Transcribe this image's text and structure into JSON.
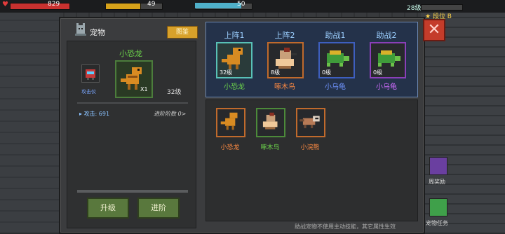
{
  "hud": {
    "hp_value": "829",
    "gold_value": "49",
    "energy_value": "50",
    "level_value": "28级",
    "rank_label": "段位 B",
    "hp_fraction": 1.0,
    "gold_fraction": 0.6,
    "energy_fraction": 0.8
  },
  "dialog": {
    "title": "宠物",
    "rank_button": "图鉴",
    "close_glyph": "✕"
  },
  "detail": {
    "pet_name": "小恐龙",
    "skill_label": "攻击仪",
    "count": "X1",
    "level": "32级",
    "attack": "攻击: 691",
    "advance_progress": "进阶阶数 0>",
    "upgrade_button": "升级",
    "advance_button": "进阶"
  },
  "lineup": {
    "slots": [
      {
        "header": "上阵1",
        "level": "32级",
        "name": "小恐龙",
        "name_color": "#6cd44b",
        "border": "#58c1b7"
      },
      {
        "header": "上阵2",
        "level": "8级",
        "name": "啄木鸟",
        "name_color": "#ff8b42",
        "border": "#c06a2c"
      },
      {
        "header": "助战1",
        "level": "0级",
        "name": "小乌龟",
        "name_color": "#6f94ff",
        "border": "#3e5fbf"
      },
      {
        "header": "助战2",
        "level": "0级",
        "name": "小乌龟",
        "name_color": "#d06cff",
        "border": "#8a3fb8"
      }
    ]
  },
  "inventory": {
    "items": [
      {
        "name": "小恐龙",
        "name_color": "#ff8b42",
        "border": "#c06a2c"
      },
      {
        "name": "啄木鸟",
        "name_color": "#6cd44b",
        "border": "#4c8a3a"
      },
      {
        "name": "小浣熊",
        "name_color": "#ff8b42",
        "border": "#c06a2c"
      }
    ]
  },
  "side": {
    "weekly_reward": "周奖励",
    "pet_task": "宠物任务"
  },
  "footer": {
    "note": "助战宠物不使用主动技能，其它属性生效"
  }
}
